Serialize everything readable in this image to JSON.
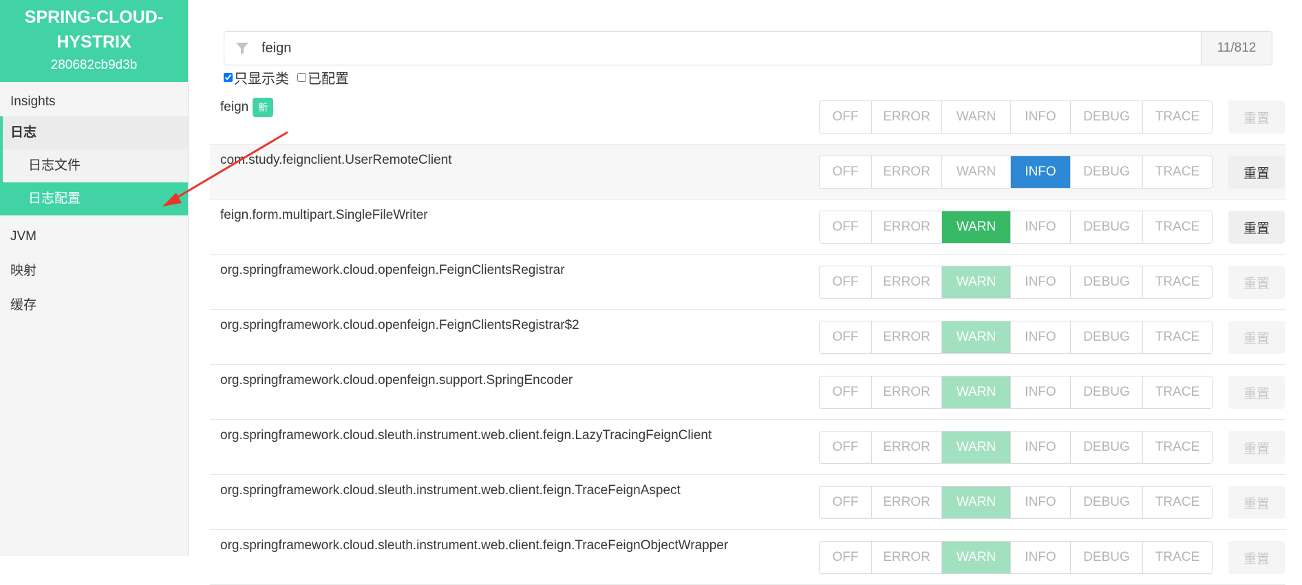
{
  "app": {
    "name": "SPRING-CLOUD-HYSTRIX",
    "id": "280682cb9d3b"
  },
  "nav": {
    "insights": "Insights",
    "logs": "日志",
    "log_file": "日志文件",
    "log_config": "日志配置",
    "jvm": "JVM",
    "mappings": "映射",
    "cache": "缓存"
  },
  "filter": {
    "value": "feign",
    "count": "11/812"
  },
  "checks": {
    "classes_only": "只显示类",
    "configured": "已配置"
  },
  "levels": {
    "off": "OFF",
    "error": "ERROR",
    "warn": "WARN",
    "info": "INFO",
    "debug": "DEBUG",
    "trace": "TRACE"
  },
  "reset_label": "重置",
  "new_badge": "新",
  "rows": [
    {
      "name": "feign",
      "configured": null,
      "effective": null
    },
    {
      "name": "com.study.feignclient.UserRemoteClient",
      "configured": "INFO",
      "effective": "INFO"
    },
    {
      "name": "feign.form.multipart.SingleFileWriter",
      "configured": "WARN",
      "effective": "WARN"
    },
    {
      "name": "org.springframework.cloud.openfeign.FeignClientsRegistrar",
      "configured": null,
      "effective": "WARN"
    },
    {
      "name": "org.springframework.cloud.openfeign.FeignClientsRegistrar$2",
      "configured": null,
      "effective": "WARN"
    },
    {
      "name": "org.springframework.cloud.openfeign.support.SpringEncoder",
      "configured": null,
      "effective": "WARN"
    },
    {
      "name": "org.springframework.cloud.sleuth.instrument.web.client.feign.LazyTracingFeignClient",
      "configured": null,
      "effective": "WARN"
    },
    {
      "name": "org.springframework.cloud.sleuth.instrument.web.client.feign.TraceFeignAspect",
      "configured": null,
      "effective": "WARN"
    },
    {
      "name": "org.springframework.cloud.sleuth.instrument.web.client.feign.TraceFeignObjectWrapper",
      "configured": null,
      "effective": "WARN"
    }
  ],
  "colors": {
    "accent": "#42d3a5",
    "info_selected": "#2d89d6",
    "warn_selected": "#37b966",
    "warn_effective": "#a2e1bf",
    "annotation_arrow": "#e8372d"
  }
}
